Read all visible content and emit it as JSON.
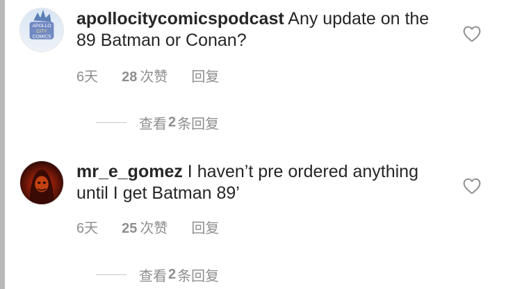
{
  "comments": [
    {
      "username": "apollocitycomicspodcast",
      "text": " Any update on the 89 Batman or Conan?",
      "time": "6天",
      "likes_count": "28",
      "likes_suffix": "次赞",
      "reply_label": "回复",
      "view_prefix": "查看",
      "view_count": "2",
      "view_suffix": "条回复",
      "avatar_text": [
        "APOLLO",
        "CITY",
        "COMICS"
      ]
    },
    {
      "username": "mr_e_gomez",
      "text": " I haven’t pre ordered anything until I get Batman 89’",
      "time": "6天",
      "likes_count": "25",
      "likes_suffix": "次赞",
      "reply_label": "回复",
      "view_prefix": "查看",
      "view_count": "2",
      "view_suffix": "条回复"
    }
  ],
  "icons": {
    "like": "heart-outline-icon"
  },
  "colors": {
    "text": "#262626",
    "meta": "#8e8e8e",
    "divider": "#c7c7c7"
  }
}
